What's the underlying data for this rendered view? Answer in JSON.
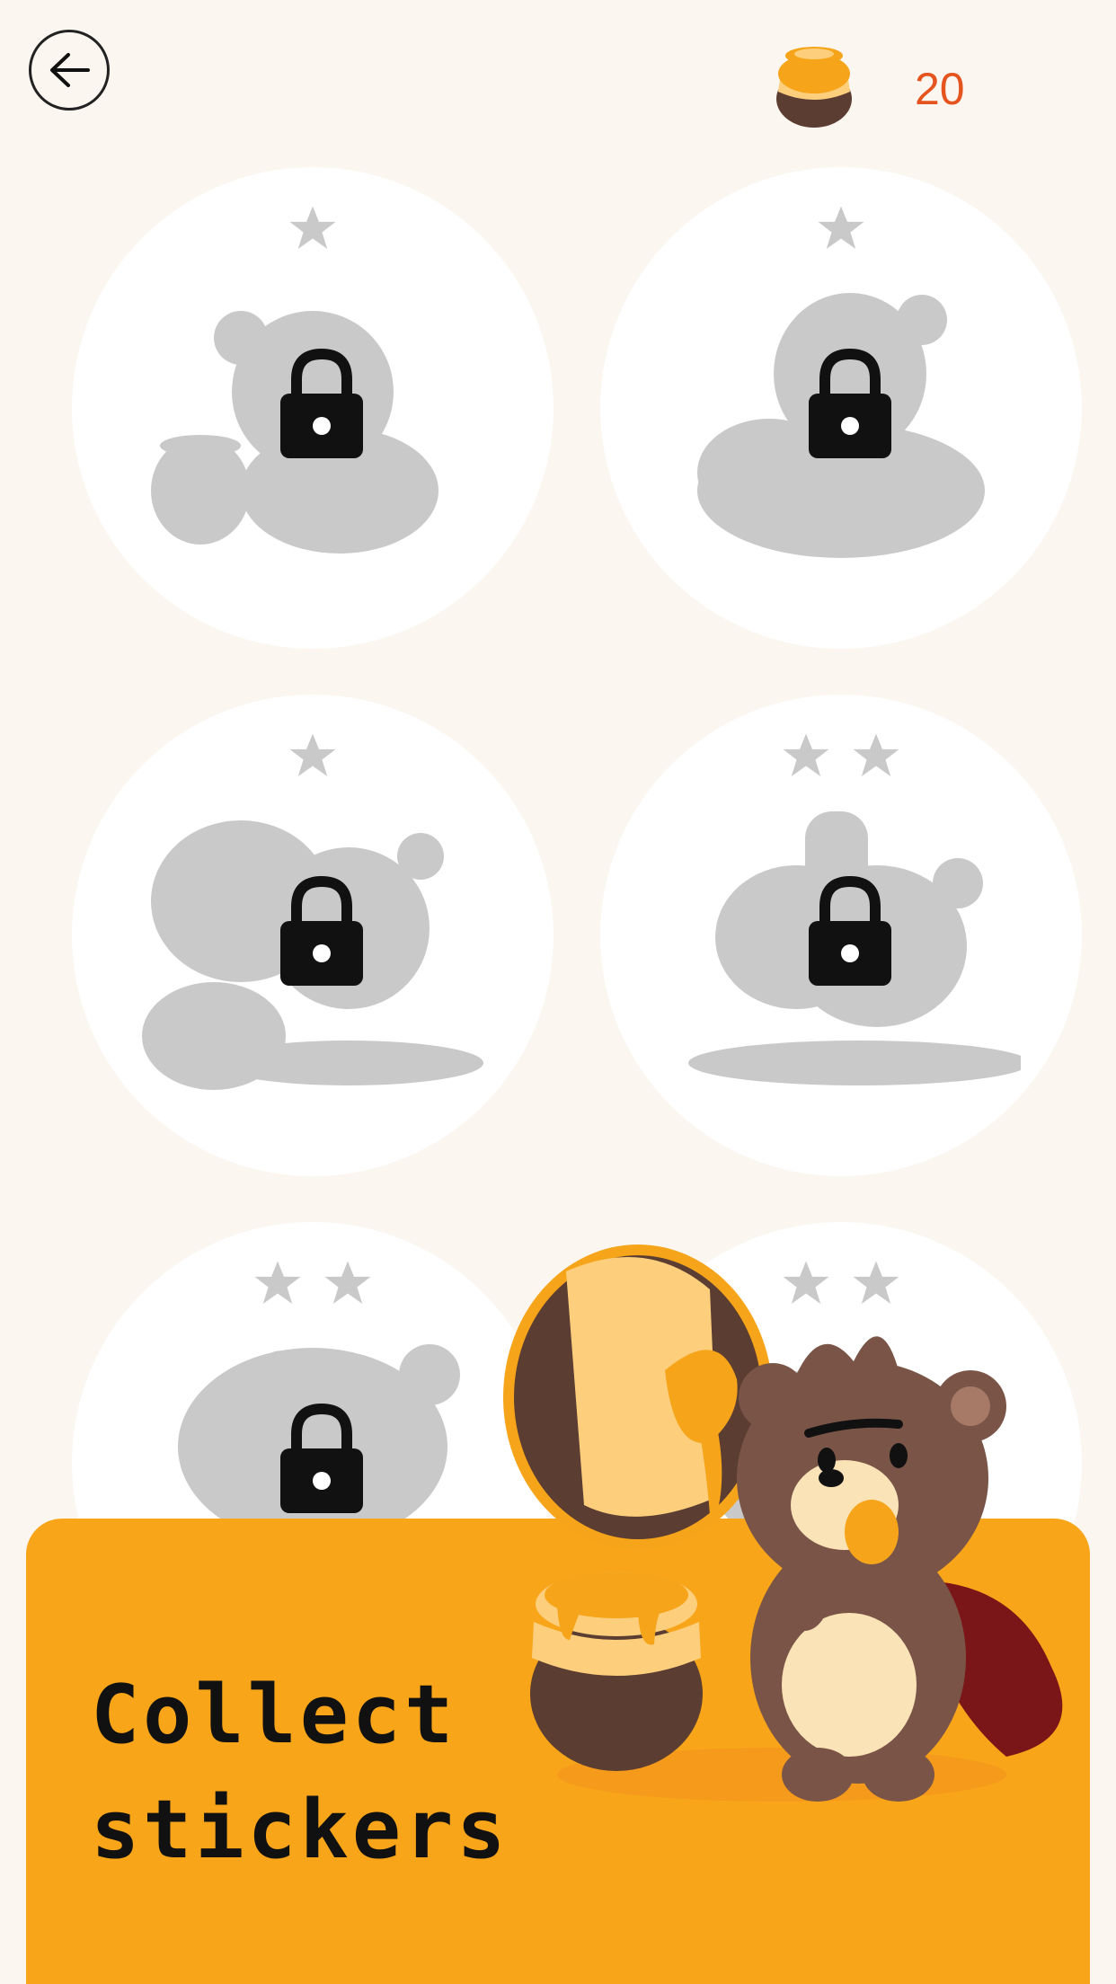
{
  "header": {
    "back_icon": "arrow-left-icon",
    "currency_icon": "honey-pot-icon",
    "coins": "20"
  },
  "stickers": [
    {
      "stars": 1,
      "locked": true,
      "silhouette": "bear-with-pot"
    },
    {
      "stars": 1,
      "locked": true,
      "silhouette": "bear-hugging-pot"
    },
    {
      "stars": 1,
      "locked": true,
      "silhouette": "bear-sitting-with-pot"
    },
    {
      "stars": 2,
      "locked": true,
      "silhouette": "bear-pouring-honey"
    },
    {
      "stars": 2,
      "locked": true,
      "silhouette": "bear-head"
    },
    {
      "stars": 2,
      "locked": true,
      "silhouette": "bear-pouring-jar"
    }
  ],
  "promo": {
    "text": "Collect\nstickers"
  },
  "colors": {
    "background": "#fbf6ef",
    "card": "#ffffff",
    "silhouette": "#c9c9c9",
    "accent_orange": "#f8a519",
    "coins_text": "#e5531e"
  }
}
